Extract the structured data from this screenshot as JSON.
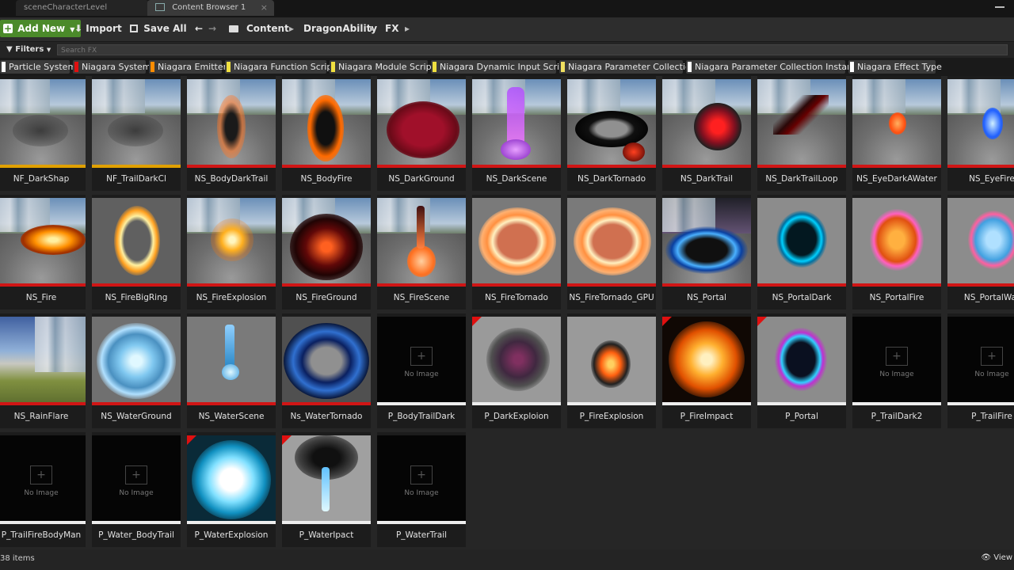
{
  "window": {
    "tabs": [
      {
        "label": "sceneCharacterLevel"
      },
      {
        "label": "Content Browser 1"
      }
    ]
  },
  "toolbar": {
    "add_new_label": "Add New",
    "import_label": "Import",
    "save_all_label": "Save All",
    "breadcrumbs": [
      "Content",
      "DragonAbility",
      "FX"
    ]
  },
  "filterbar": {
    "filters_label": "Filters",
    "search_placeholder": "Search FX"
  },
  "filter_chips": [
    {
      "label": "Particle System",
      "color": "#ffffff"
    },
    {
      "label": "Niagara System",
      "color": "#e01010"
    },
    {
      "label": "Niagara Emitter",
      "color": "#ff8c00"
    },
    {
      "label": "Niagara Function Script",
      "color": "#f0e040"
    },
    {
      "label": "Niagara Module Script",
      "color": "#f0e040"
    },
    {
      "label": "Niagara Dynamic Input Script",
      "color": "#f0e040"
    },
    {
      "label": "Niagara Parameter Collection",
      "color": "#f0e060"
    },
    {
      "label": "Niagara Parameter Collection Instance",
      "color": "#ffffff"
    },
    {
      "label": "Niagara Effect Type",
      "color": "#ffffff"
    }
  ],
  "assets": [
    {
      "name": "NF_DarkShap",
      "type": "emitter",
      "thumb": "dark-shadow",
      "new": false
    },
    {
      "name": "NF_TrailDarkCl",
      "type": "emitter",
      "thumb": "dark-shadow",
      "new": false
    },
    {
      "name": "NS_BodyDarkTrail",
      "type": "system",
      "thumb": "body-dark",
      "new": false
    },
    {
      "name": "NS_BodyFire",
      "type": "system",
      "thumb": "body-fire",
      "new": false
    },
    {
      "name": "NS_DarkGround",
      "type": "system",
      "thumb": "red-ground",
      "new": false
    },
    {
      "name": "NS_DarkScene",
      "type": "system",
      "thumb": "purple-beam",
      "new": false
    },
    {
      "name": "NS_DarkTornado",
      "type": "system",
      "thumb": "dark-ring",
      "new": false
    },
    {
      "name": "NS_DarkTrail",
      "type": "system",
      "thumb": "red-burst",
      "new": false
    },
    {
      "name": "NS_DarkTrailLoop",
      "type": "system",
      "thumb": "dark-streak",
      "new": false
    },
    {
      "name": "NS_EyeDarkAWater",
      "type": "system",
      "thumb": "small-fire",
      "new": false
    },
    {
      "name": "NS_EyeFire",
      "type": "system",
      "thumb": "blue-flame",
      "new": false
    },
    {
      "name": "NS_Fire",
      "type": "system",
      "thumb": "fire-streak",
      "new": false
    },
    {
      "name": "NS_FireBigRing",
      "type": "system",
      "thumb": "fire-ring",
      "new": false
    },
    {
      "name": "NS_FireExplosion",
      "type": "system",
      "thumb": "fire-burst",
      "new": false
    },
    {
      "name": "NS_FireGround",
      "type": "system",
      "thumb": "lava",
      "new": false
    },
    {
      "name": "NS_FireScene",
      "type": "system",
      "thumb": "fire-beam",
      "new": false
    },
    {
      "name": "NS_FireTornado",
      "type": "system",
      "thumb": "fire-circle",
      "new": false
    },
    {
      "name": "NS_FireTornado_GPU",
      "type": "system",
      "thumb": "fire-circle",
      "new": false
    },
    {
      "name": "NS_Portal",
      "type": "system",
      "thumb": "blue-ring",
      "new": false
    },
    {
      "name": "NS_PortalDark",
      "type": "system",
      "thumb": "portal-cyan",
      "new": false
    },
    {
      "name": "NS_PortalFire",
      "type": "system",
      "thumb": "portal-fire",
      "new": false
    },
    {
      "name": "NS_PortalWat",
      "type": "system",
      "thumb": "portal-water",
      "new": false
    },
    {
      "name": "NS_RainFlare",
      "type": "system",
      "thumb": "sky",
      "new": false
    },
    {
      "name": "NS_WaterGround",
      "type": "system",
      "thumb": "water-swirl",
      "new": false
    },
    {
      "name": "NS_WaterScene",
      "type": "system",
      "thumb": "water-beam",
      "new": false
    },
    {
      "name": "Ns_WaterTornado",
      "type": "system",
      "thumb": "water-tornado",
      "new": false
    },
    {
      "name": "P_BodyTrailDark",
      "type": "particle",
      "thumb": "none",
      "new": false
    },
    {
      "name": "P_DarkExploion",
      "type": "particle",
      "thumb": "dark-smoke",
      "new": true
    },
    {
      "name": "P_FireExplosion",
      "type": "particle",
      "thumb": "fire-smoke",
      "new": false
    },
    {
      "name": "P_FireImpact",
      "type": "particle",
      "thumb": "fire-impact",
      "new": true
    },
    {
      "name": "P_Portal",
      "type": "particle",
      "thumb": "portal-p",
      "new": true
    },
    {
      "name": "P_TrailDark2",
      "type": "particle",
      "thumb": "none",
      "new": false
    },
    {
      "name": "P_TrailFire",
      "type": "particle",
      "thumb": "none",
      "new": false
    },
    {
      "name": "P_TrailFireBodyMan",
      "type": "particle",
      "thumb": "none",
      "new": false
    },
    {
      "name": "P_Water_BodyTrail",
      "type": "particle",
      "thumb": "none",
      "new": false
    },
    {
      "name": "P_WaterExplosion",
      "type": "particle",
      "thumb": "water-explosion",
      "new": true
    },
    {
      "name": "P_WaterIpact",
      "type": "particle",
      "thumb": "water-impact",
      "new": true
    },
    {
      "name": "P_WaterTrail",
      "type": "particle",
      "thumb": "none",
      "new": false
    }
  ],
  "no_image_label": "No Image",
  "type_colors": {
    "emitter": "#e0a000",
    "system": "#d01515",
    "particle": "#eeeeee"
  },
  "status": {
    "item_count": "38 items",
    "view_options_label": "View"
  }
}
